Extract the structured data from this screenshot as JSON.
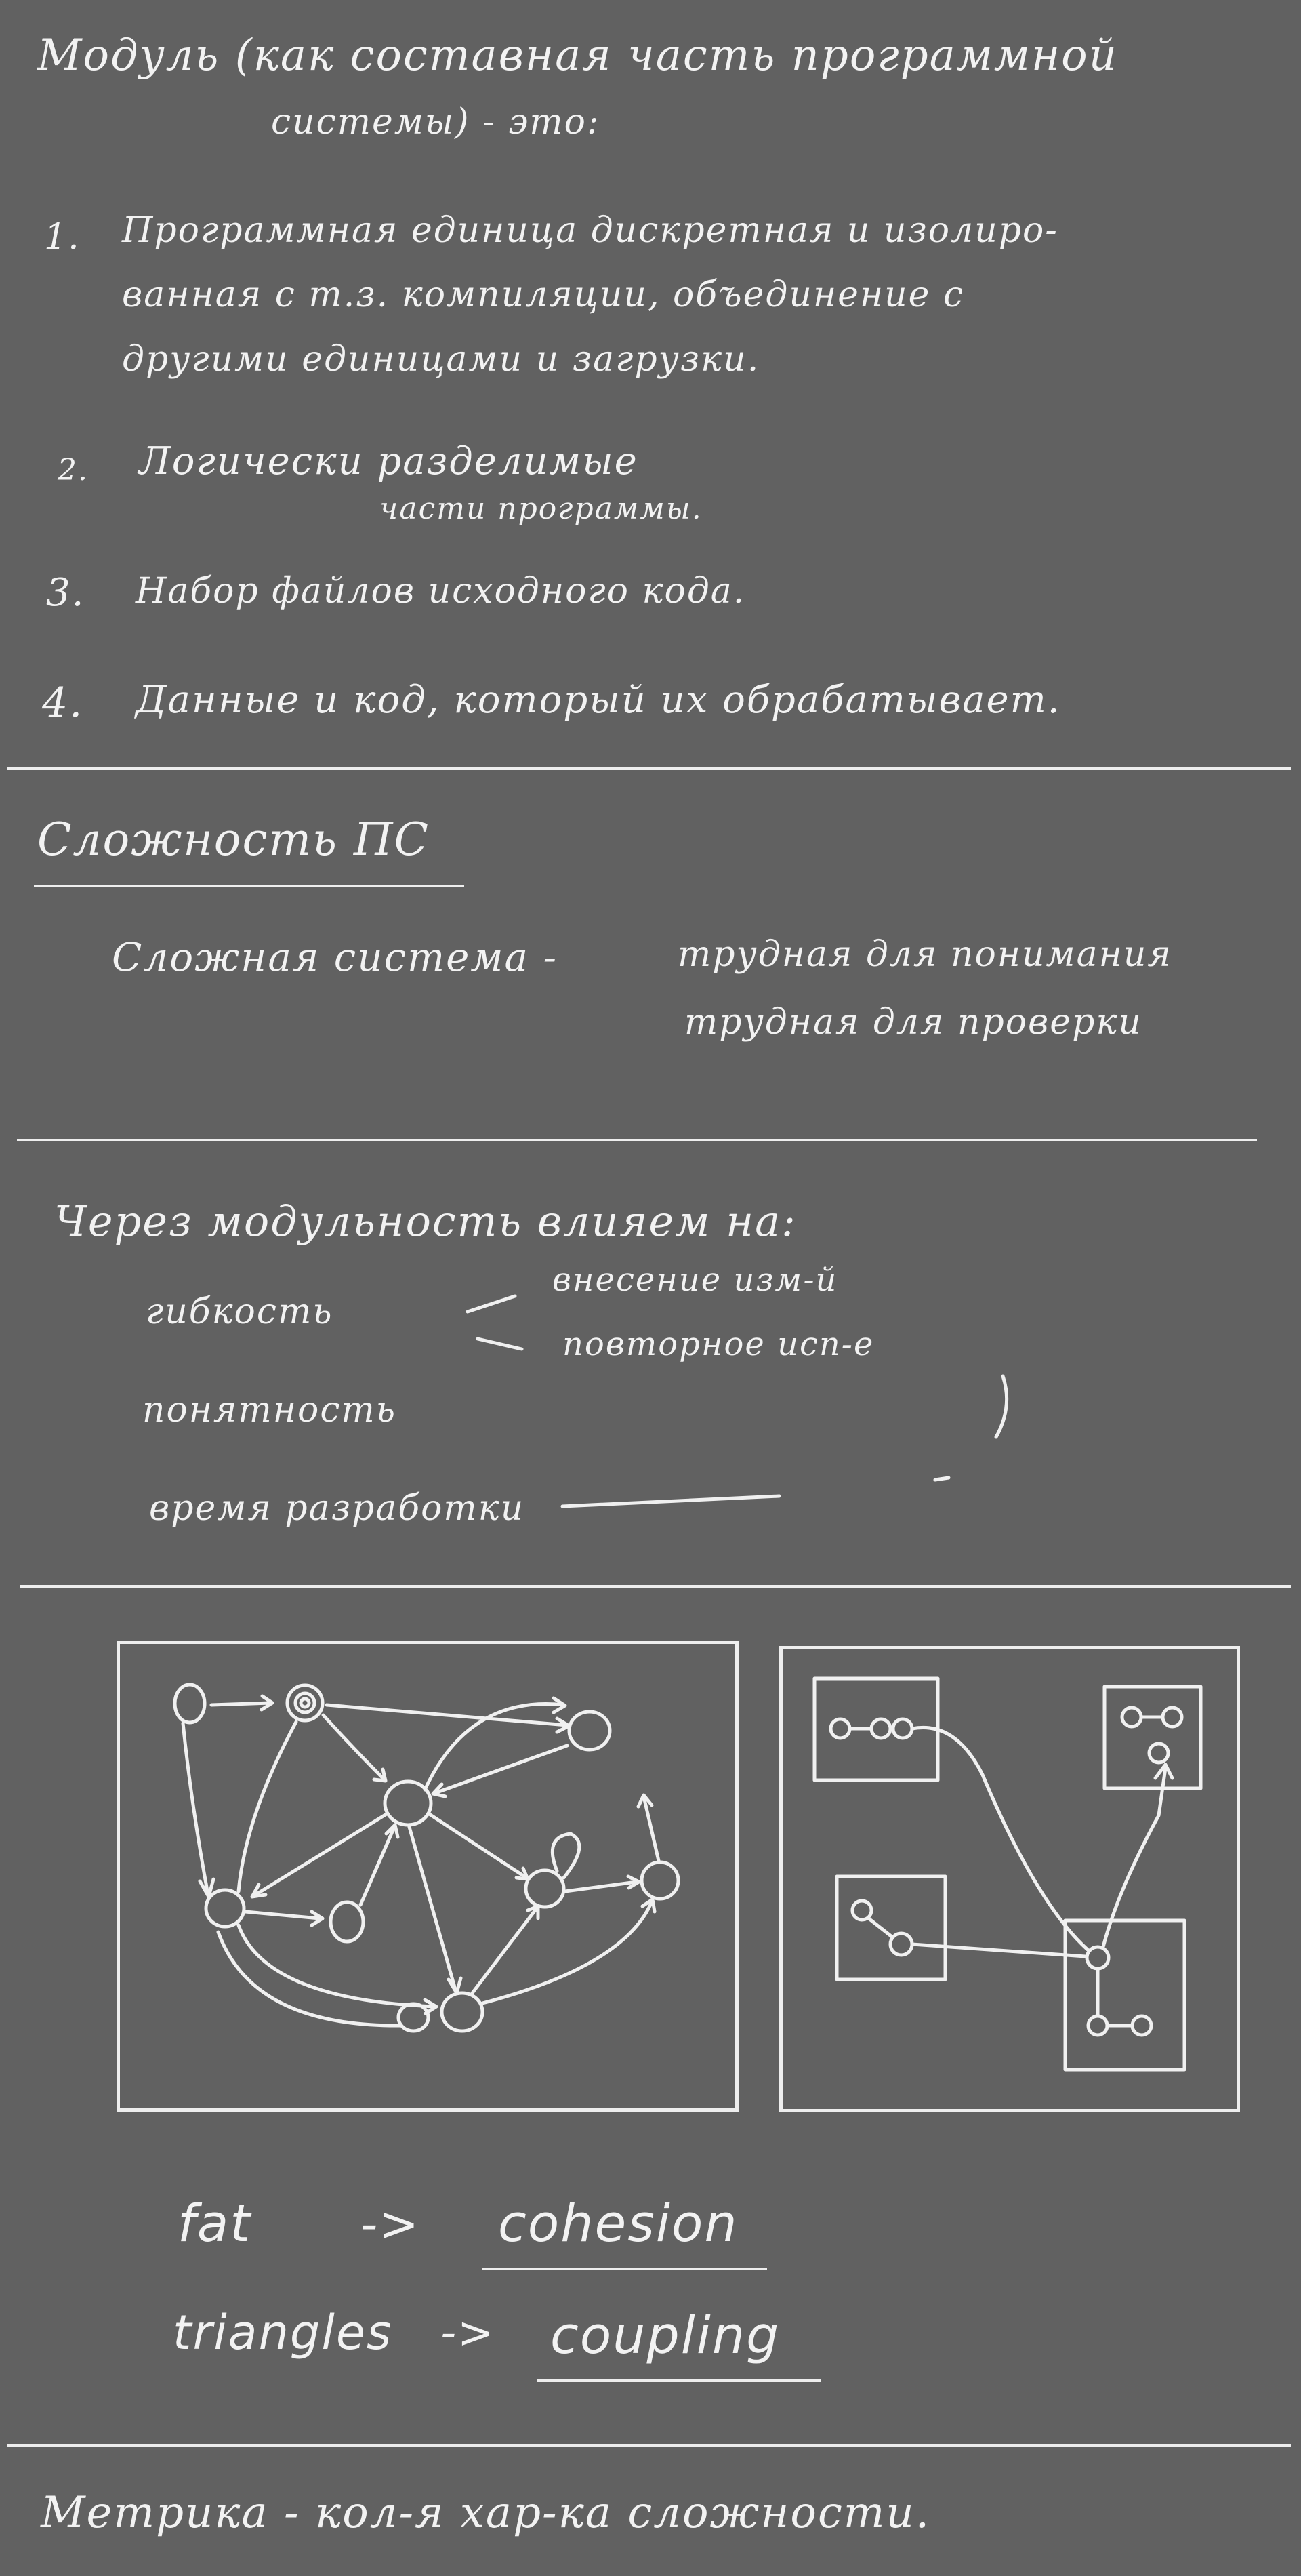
{
  "module_section": {
    "title_line1": "Модуль (как составная часть программной",
    "title_line2": "системы) - это:",
    "items": [
      {
        "num": "1.",
        "line1": "Программная единица дискретная и изолиро-",
        "line2": "ванная с т.з. компиляции, объединение с",
        "line3": "другими единицами и загрузки."
      },
      {
        "num": "2.",
        "line1": "Логически разделимые",
        "line2": "части программы."
      },
      {
        "num": "3.",
        "line1": "Набор файлов исходного кода."
      },
      {
        "num": "4.",
        "line1": "Данные и код, который их обрабатывает."
      }
    ]
  },
  "complexity_section": {
    "heading": "Сложность ПС",
    "line1_left": "Сложная система -",
    "line1_right": "трудная для понимания",
    "line2_right": "трудная для проверки"
  },
  "modularity_section": {
    "intro": "Через модульность влияем на:",
    "item1": "гибкость",
    "branch1": "внесение изм-й",
    "branch2": "повторное исп-е",
    "item2": "понятность",
    "item3": "время разработки"
  },
  "relations": {
    "line1_left": "fat",
    "line1_arrow": "->",
    "line1_right": "cohesion",
    "line2_left": "triangles",
    "line2_arrow": "->",
    "line2_right": "coupling"
  },
  "metrics": {
    "text": "Метрика - кол-я хар-ка сложности."
  }
}
